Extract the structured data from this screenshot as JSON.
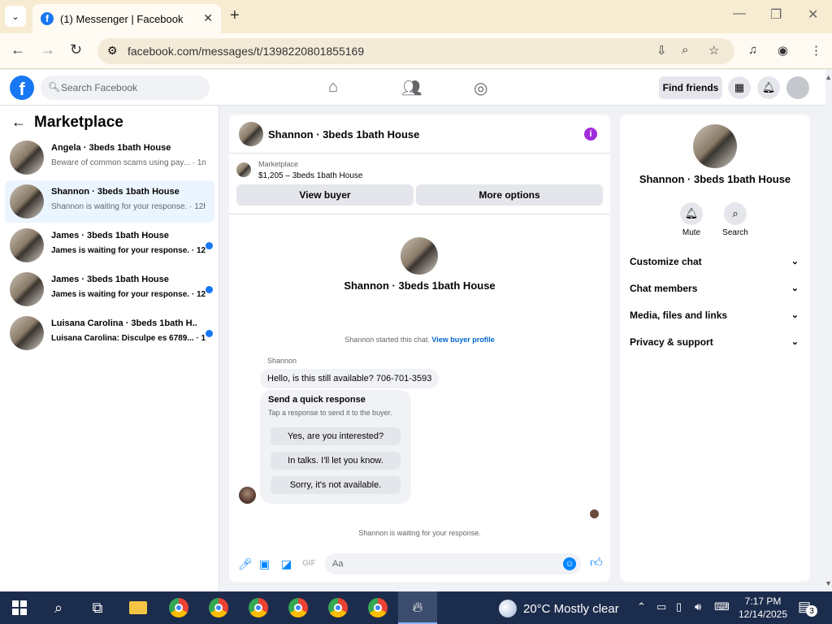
{
  "browser": {
    "tab_title": "(1) Messenger | Facebook",
    "url": "facebook.com/messages/t/1398220801855169"
  },
  "header": {
    "search_placeholder": "Search Facebook",
    "find_friends": "Find friends",
    "brand_color": "#1877f2"
  },
  "left": {
    "title": "Marketplace",
    "conversations": [
      {
        "name": "Angela · 3beds 1bath House",
        "preview": "Beware of common scams using pay... · 1m",
        "unread": false,
        "active": false
      },
      {
        "name": "Shannon · 3beds 1bath House",
        "preview": "Shannon is waiting for your response. · 12h",
        "unread": false,
        "active": true
      },
      {
        "name": "James · 3beds 1bath House",
        "preview": "James is waiting for your response. · 12h",
        "unread": true,
        "active": false
      },
      {
        "name": "James · 3beds 1bath House",
        "preview": "James is waiting for your response. · 12h",
        "unread": true,
        "active": false
      },
      {
        "name": "Luisana Carolina · 3beds 1bath H...",
        "preview": "Luisana Carolina: Disculpe es 6789... · 1d",
        "unread": true,
        "active": false
      }
    ]
  },
  "chat": {
    "title": "Shannon · 3beds 1bath House",
    "marketplace_label": "Marketplace",
    "listing": "$1,205 – 3beds 1bath House",
    "view_buyer": "View buyer",
    "more_options": "More options",
    "center_name": "Shannon · 3beds 1bath House",
    "started_text": "Shannon started this chat.",
    "view_buyer_profile": "View buyer profile",
    "sender": "Shannon",
    "message": "Hello, is this still available? 706-701-3593",
    "quick_title": "Send a quick response",
    "quick_sub": "Tap a response to send it to the buyer.",
    "quick_responses": [
      "Yes, are you interested?",
      "In talks. I'll let you know.",
      "Sorry, it's not available."
    ],
    "waiting": "Shannon is waiting for your response.",
    "input_placeholder": "Aa"
  },
  "right": {
    "name": "Shannon · 3beds 1bath House",
    "mute": "Mute",
    "search": "Search",
    "sections": [
      "Customize chat",
      "Chat members",
      "Media, files and links",
      "Privacy & support"
    ]
  },
  "taskbar": {
    "weather": "20°C  Mostly clear",
    "time": "7:17 PM",
    "date": "12/14/2025",
    "notifications": "3"
  }
}
